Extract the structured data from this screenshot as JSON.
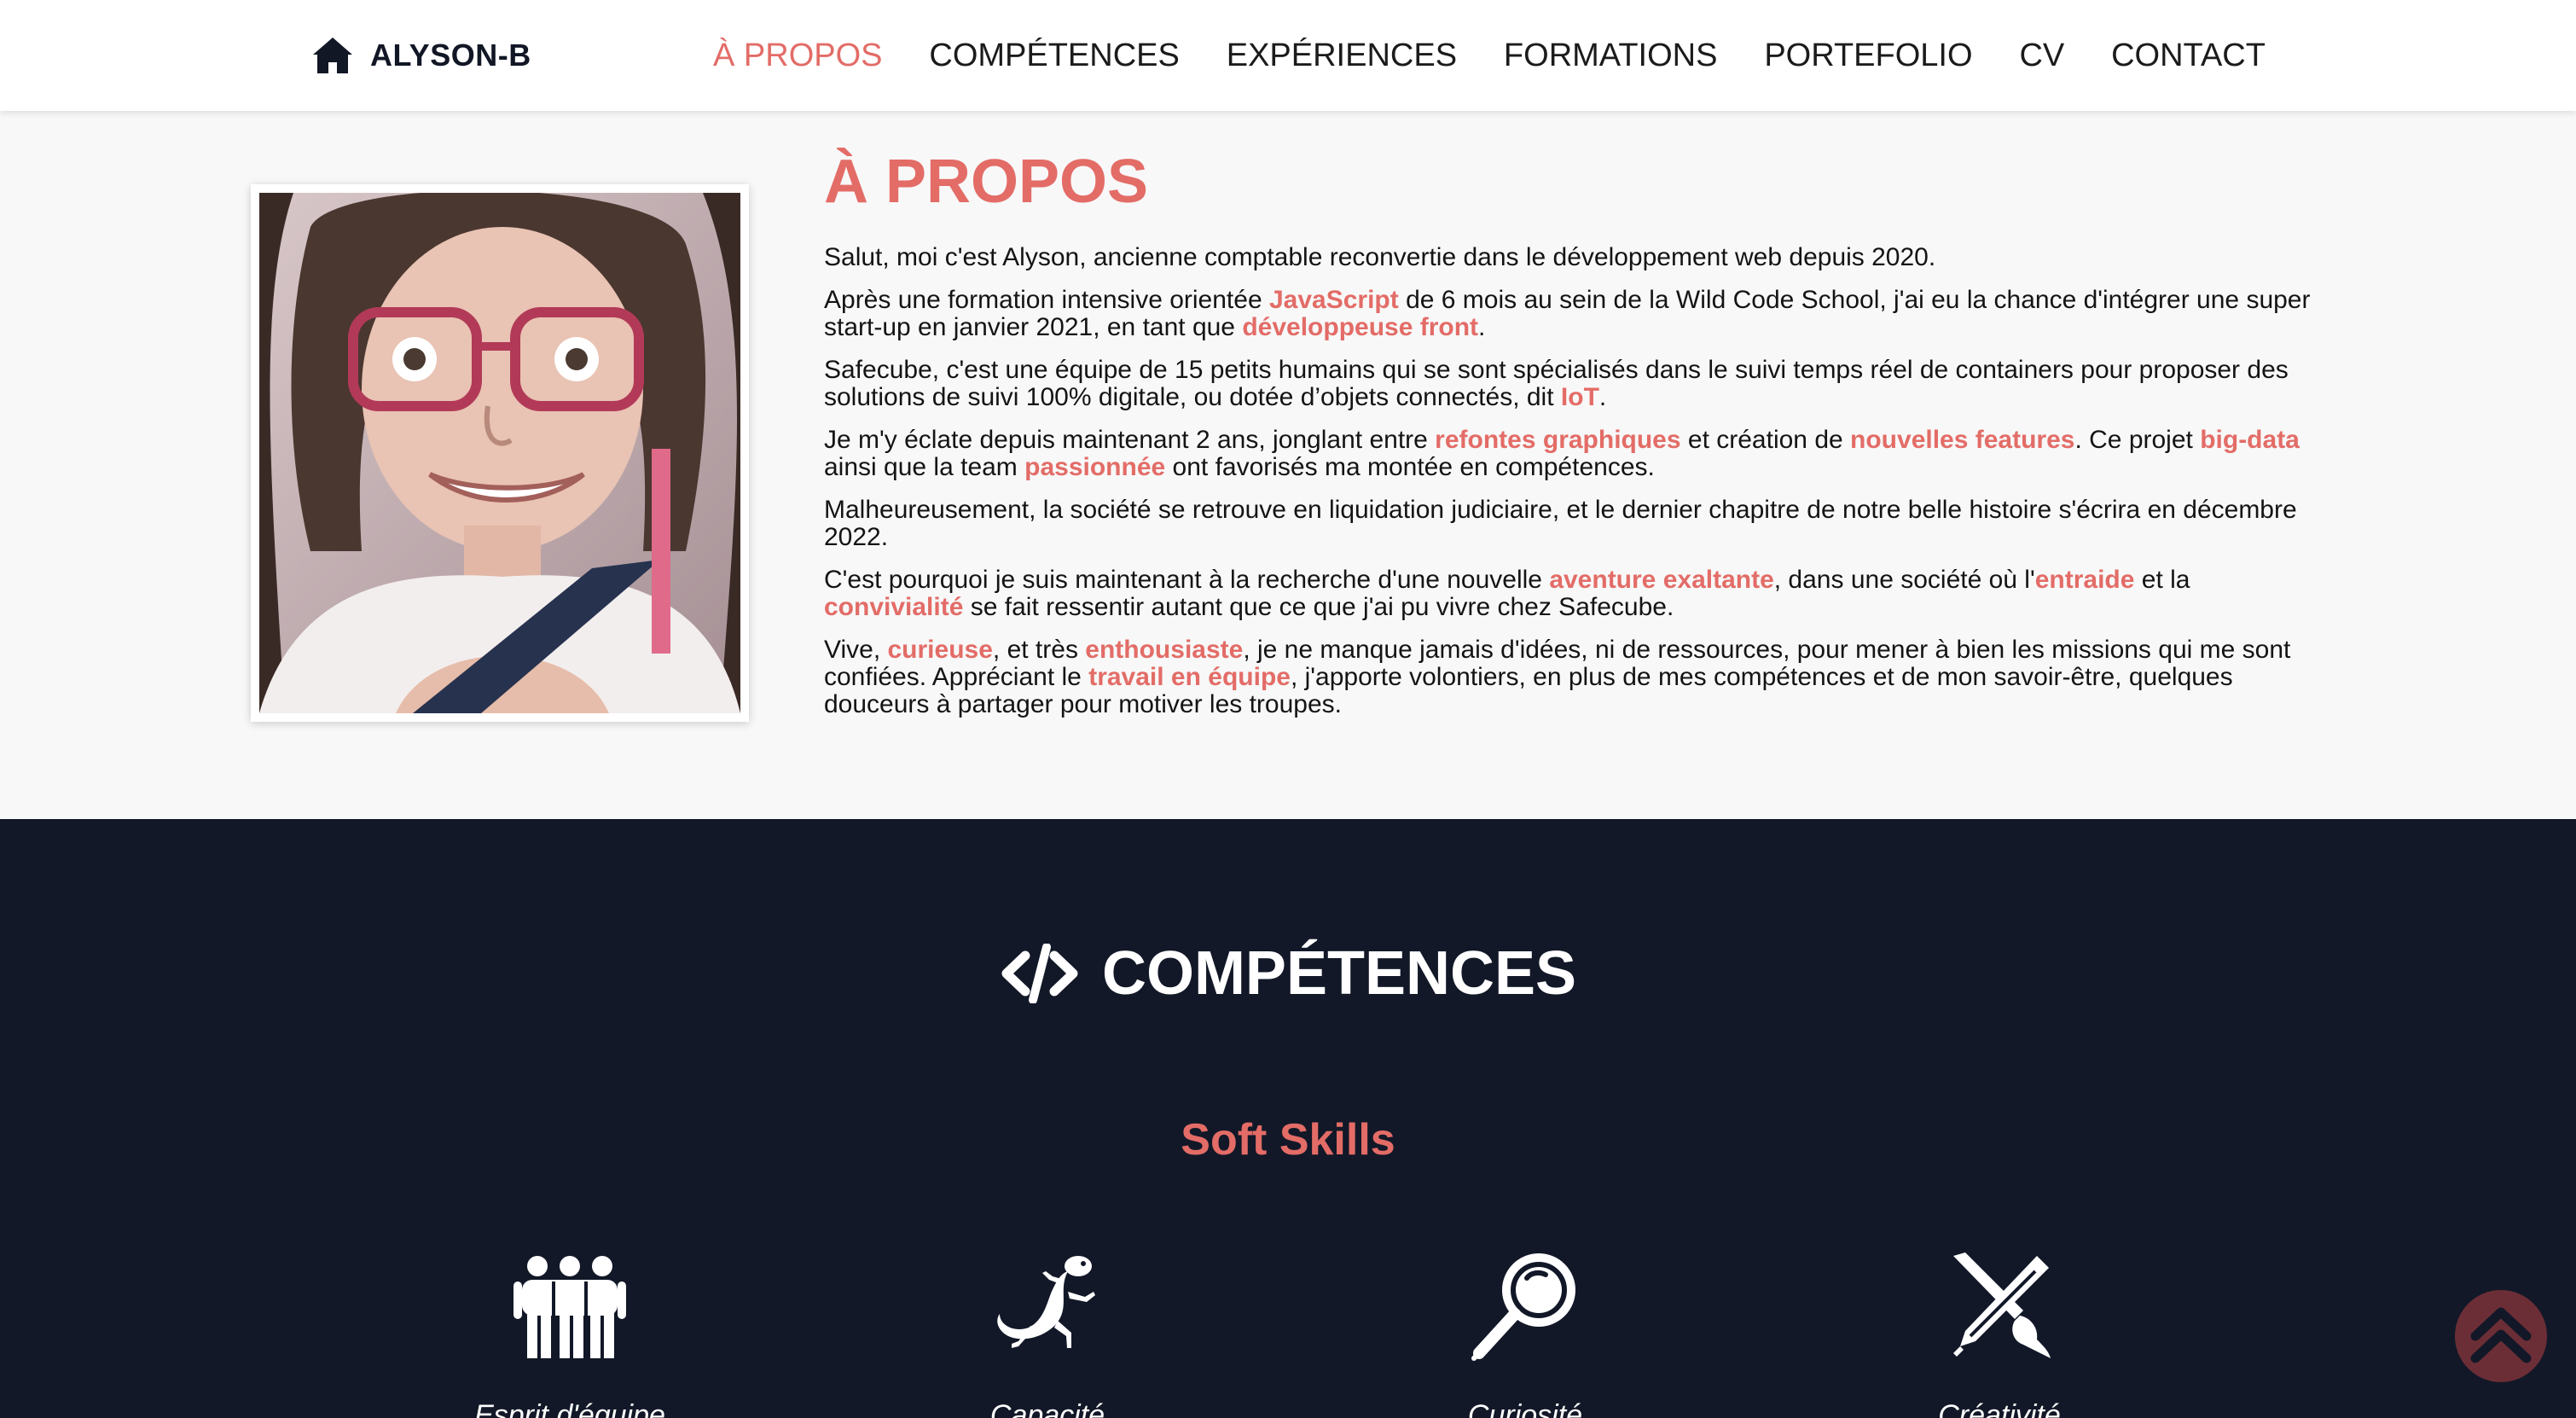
{
  "brand": {
    "icon": "home-icon",
    "label": "ALYSON-B"
  },
  "nav": {
    "items": [
      {
        "label": "À PROPOS",
        "active": true
      },
      {
        "label": "COMPÉTENCES"
      },
      {
        "label": "EXPÉRIENCES"
      },
      {
        "label": "FORMATIONS"
      },
      {
        "label": "PORTEFOLIO"
      },
      {
        "label": "CV"
      },
      {
        "label": "CONTACT"
      }
    ]
  },
  "about": {
    "title": "À PROPOS",
    "photo": "profile-photo",
    "p1": "Salut, moi c'est Alyson, ancienne comptable reconvertie dans le développement web depuis 2020.",
    "p2": [
      "Après une formation intensive orientée ",
      "JavaScript",
      " de 6 mois au sein de la Wild Code School, j'ai eu la chance d'intégrer une super start-up en janvier 2021, en tant que ",
      "développeuse front",
      "."
    ],
    "p3": [
      "Safecube, c'est une équipe de 15 petits humains qui se sont spécialisés dans le suivi temps réel de containers pour proposer des solutions de suivi 100% digitale, ou dotée d’objets connectés, dit ",
      "IoT",
      "."
    ],
    "p4": [
      "Je m'y éclate depuis maintenant 2 ans, jonglant entre ",
      "refontes graphiques",
      " et création de ",
      "nouvelles features",
      ". Ce projet ",
      "big-data",
      " ainsi que la team ",
      "passionnée",
      " ont favorisés ma montée en compétences."
    ],
    "p5": "Malheureusement, la société se retrouve en liquidation judiciaire, et le dernier chapitre de notre belle histoire s'écrira en décembre 2022.",
    "p6": [
      "C'est pourquoi je suis maintenant à la recherche d'une nouvelle ",
      "aventure exaltante",
      ", dans une société où l'",
      "entraide",
      " et la ",
      "convivialité",
      " se fait ressentir autant que ce que j'ai pu vivre chez Safecube."
    ],
    "p7": [
      "Vive, ",
      "curieuse",
      ", et très ",
      "enthousiaste",
      ", je ne manque jamais d'idées, ni de ressources, pour mener à bien les missions qui me sont confiées. Appréciant le ",
      "travail en équipe",
      ", j'apporte volontiers, en plus de mes compétences et de mon savoir-être, quelques douceurs à partager pour motiver les troupes."
    ]
  },
  "skills": {
    "icon": "code-icon",
    "title": "COMPÉTENCES",
    "subtitle": "Soft Skills",
    "items": [
      {
        "icon": "team-icon",
        "label": "Esprit d'équipe"
      },
      {
        "icon": "lizard-icon",
        "label": "Capacité"
      },
      {
        "icon": "magnifier-icon",
        "label": "Curiosité"
      },
      {
        "icon": "pencil-brush-icon",
        "label": "Créativité"
      }
    ]
  },
  "scroll_top": {
    "icon": "double-chevron-up-icon"
  },
  "colors": {
    "accent": "#e36c67",
    "dark": "#121828",
    "background": "#f8f8f8"
  }
}
